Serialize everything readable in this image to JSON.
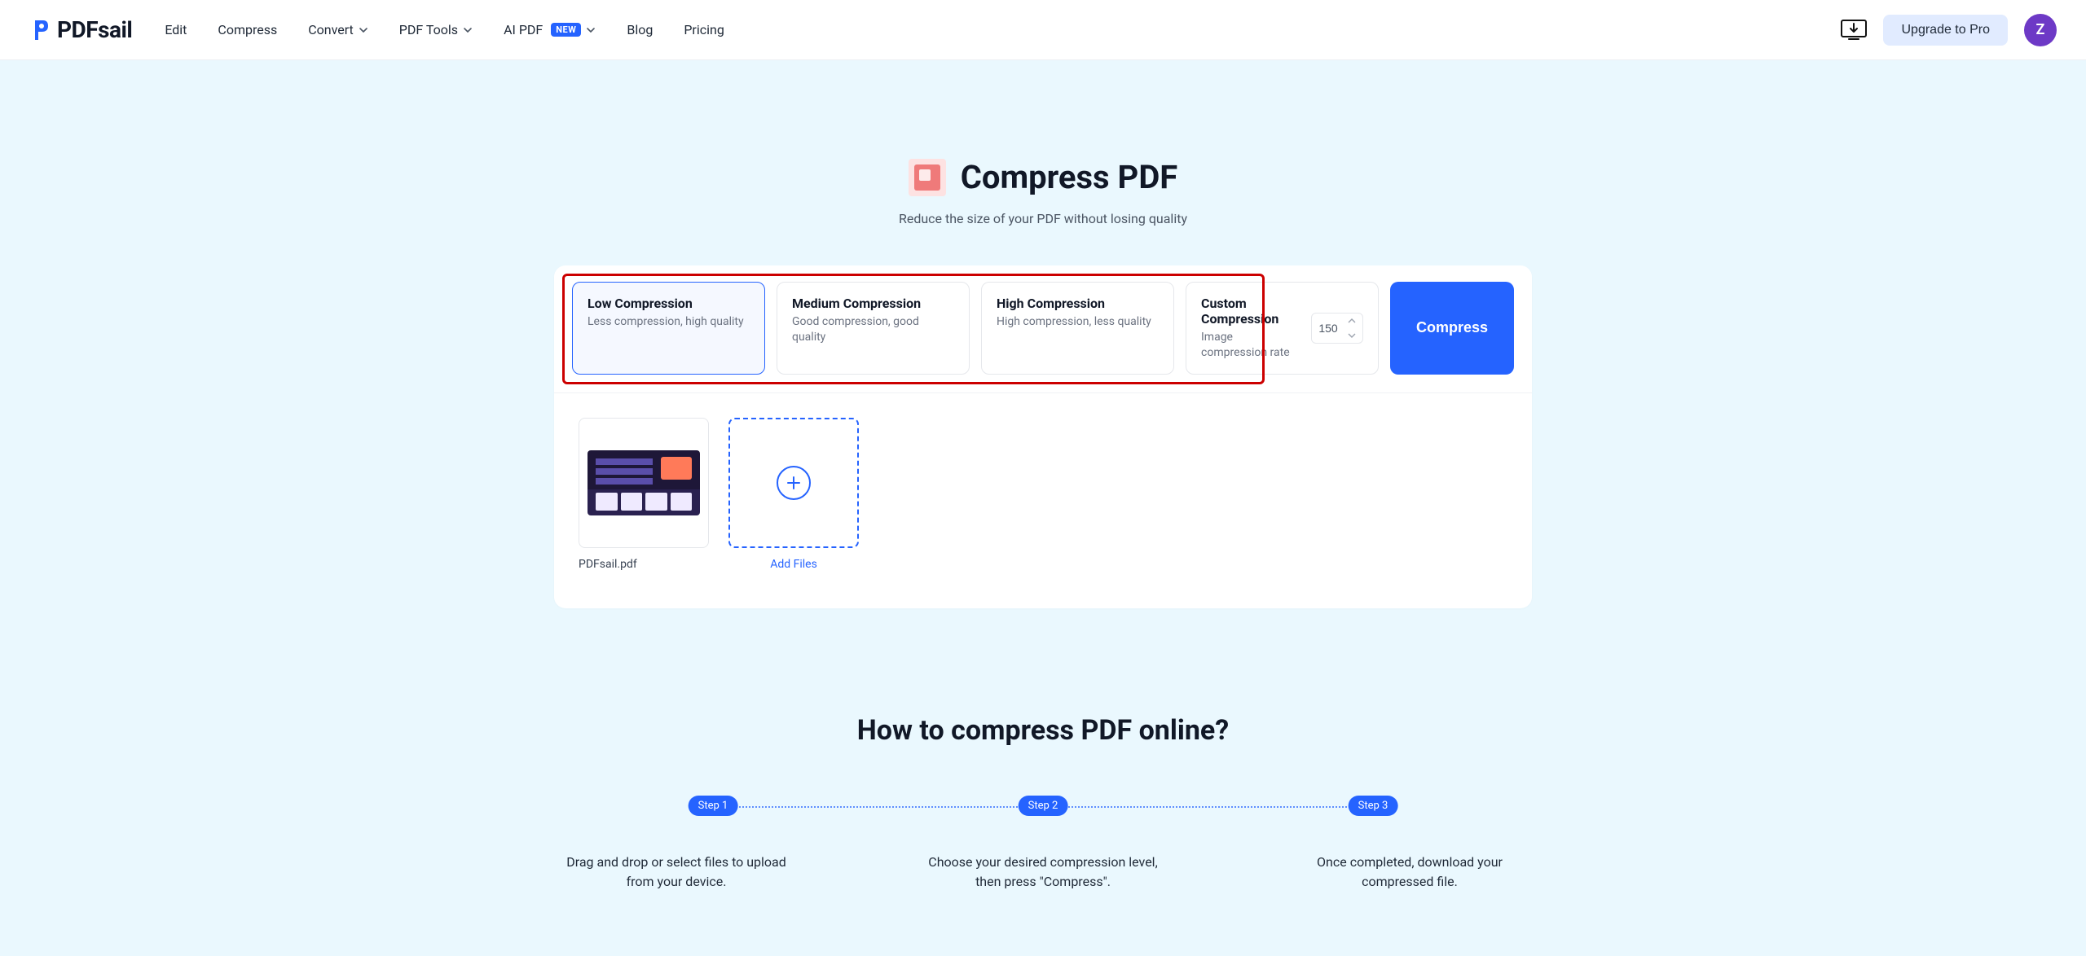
{
  "brand": {
    "name": "PDFsail"
  },
  "nav": {
    "edit": "Edit",
    "compress": "Compress",
    "convert": "Convert",
    "pdftools": "PDF Tools",
    "aipdf": "AI PDF",
    "ai_badge": "NEW",
    "blog": "Blog",
    "pricing": "Pricing"
  },
  "header": {
    "upgrade": "Upgrade to Pro",
    "avatar_initial": "Z"
  },
  "hero": {
    "title": "Compress PDF",
    "subtitle": "Reduce the size of your PDF without losing quality"
  },
  "options": {
    "low": {
      "title": "Low Compression",
      "desc": "Less compression, high quality"
    },
    "medium": {
      "title": "Medium Compression",
      "desc": "Good compression, good quality"
    },
    "high": {
      "title": "High Compression",
      "desc": "High compression, less quality"
    },
    "custom": {
      "title": "Custom Compression",
      "desc": "Image compression rate",
      "value": "150"
    },
    "selected": "low"
  },
  "actions": {
    "compress": "Compress"
  },
  "files": {
    "items": [
      {
        "name": "PDFsail.pdf"
      }
    ],
    "add_label": "Add Files"
  },
  "howto": {
    "title": "How to compress PDF online?",
    "steps": {
      "s1": {
        "label": "Step 1",
        "text": "Drag and drop or select files to upload from your device."
      },
      "s2": {
        "label": "Step 2",
        "text": "Choose your desired compression level, then press \"Compress\"."
      },
      "s3": {
        "label": "Step 3",
        "text": "Once completed, download your compressed file."
      }
    }
  }
}
